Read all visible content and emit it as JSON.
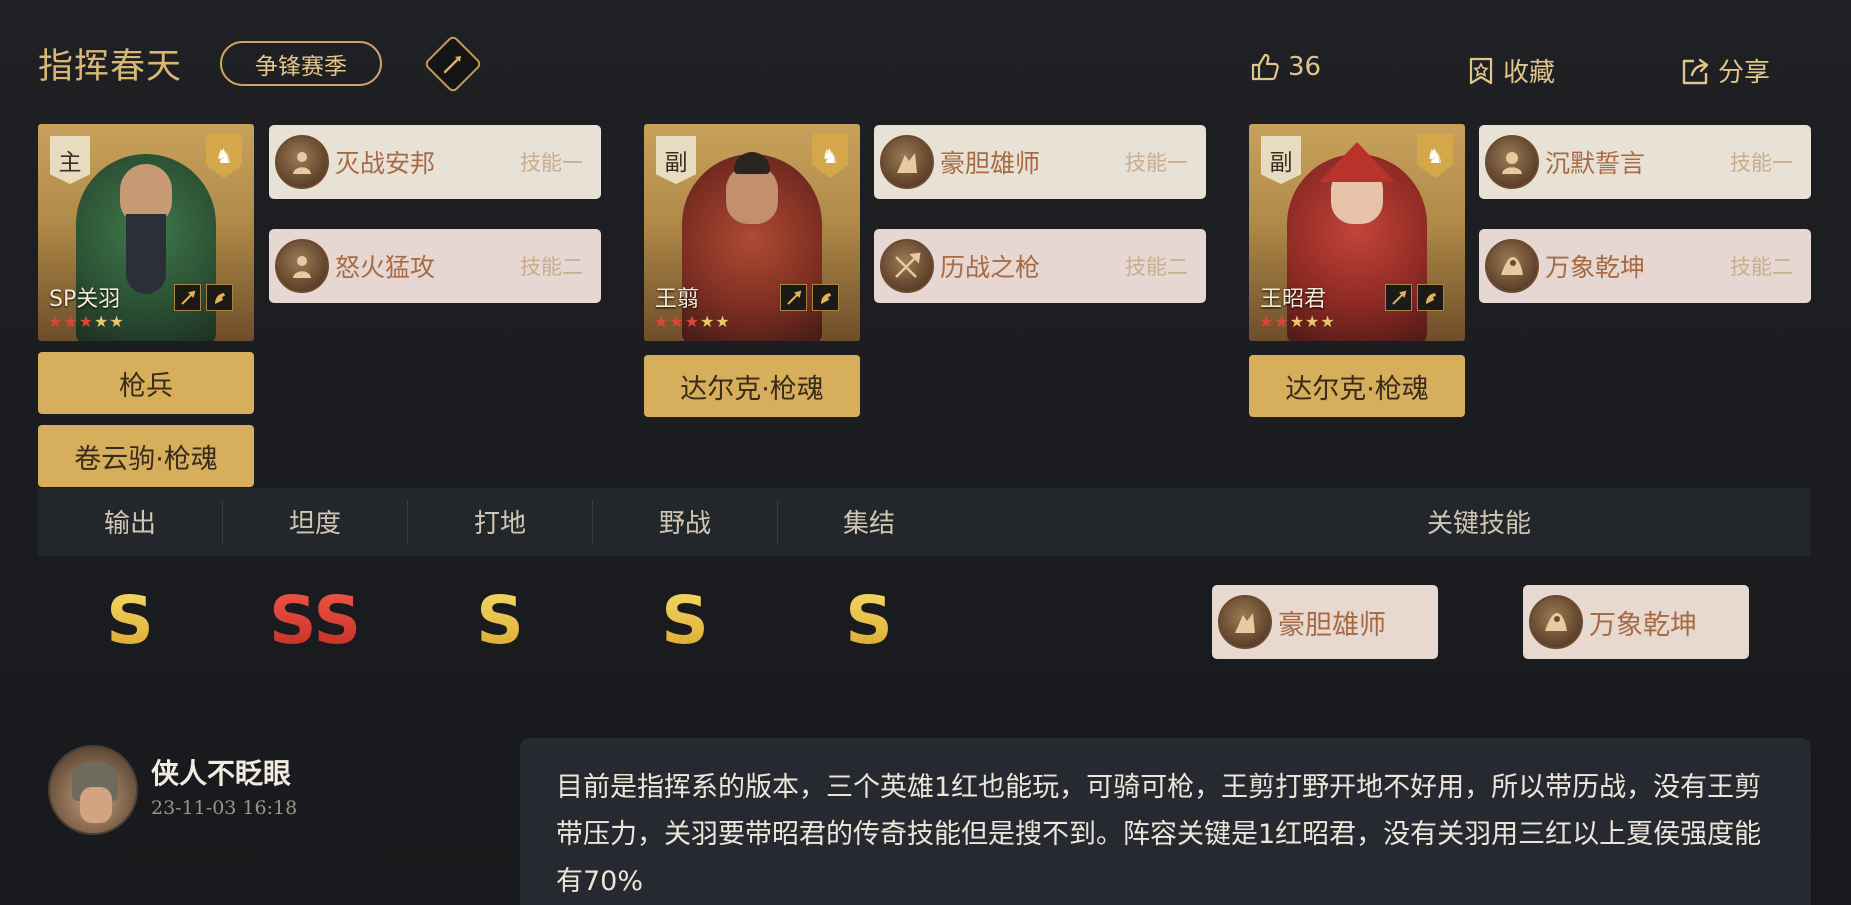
{
  "header": {
    "title": "指挥春天",
    "season": "争锋赛季",
    "likes": "36",
    "collect_label": "收藏",
    "share_label": "分享"
  },
  "heroes": [
    {
      "role": "主",
      "name": "SP关羽",
      "stars_red": 3,
      "stars_total": 5,
      "skills": [
        {
          "name": "灭战安邦",
          "slot": "技能一"
        },
        {
          "name": "怒火猛攻",
          "slot": "技能二"
        }
      ],
      "tags": [
        "枪兵",
        "卷云驹·枪魂"
      ]
    },
    {
      "role": "副",
      "name": "王翦",
      "stars_red": 3,
      "stars_total": 5,
      "skills": [
        {
          "name": "豪胆雄师",
          "slot": "技能一"
        },
        {
          "name": "历战之枪",
          "slot": "技能二"
        }
      ],
      "tags": [
        "达尔克·枪魂"
      ]
    },
    {
      "role": "副",
      "name": "王昭君",
      "stars_red": 2,
      "stars_total": 5,
      "skills": [
        {
          "name": "沉默誓言",
          "slot": "技能一"
        },
        {
          "name": "万象乾坤",
          "slot": "技能二"
        }
      ],
      "tags": [
        "达尔克·枪魂"
      ]
    }
  ],
  "stats": {
    "headers": [
      "输出",
      "坦度",
      "打地",
      "野战",
      "集结"
    ],
    "grades": [
      "S",
      "SS",
      "S",
      "S",
      "S"
    ],
    "key_skills_label": "关键技能",
    "key_skills": [
      "豪胆雄师",
      "万象乾坤"
    ]
  },
  "comment": {
    "user": "侠人不眨眼",
    "time": "23-11-03 16:18",
    "text": "目前是指挥系的版本，三个英雄1红也能玩，可骑可枪，王剪打野开地不好用，所以带历战，没有王剪带压力，关羽要带昭君的传奇技能但是搜不到。阵容关键是1红昭君，没有关羽用三红以上夏侯强度能有70%"
  },
  "colors": {
    "accent_gold": "#d6ae5c",
    "title_gold": "#d9b775",
    "grade_gold": "#e8be3f",
    "grade_red": "#d63a2e",
    "skill_text": "#a86a43"
  }
}
